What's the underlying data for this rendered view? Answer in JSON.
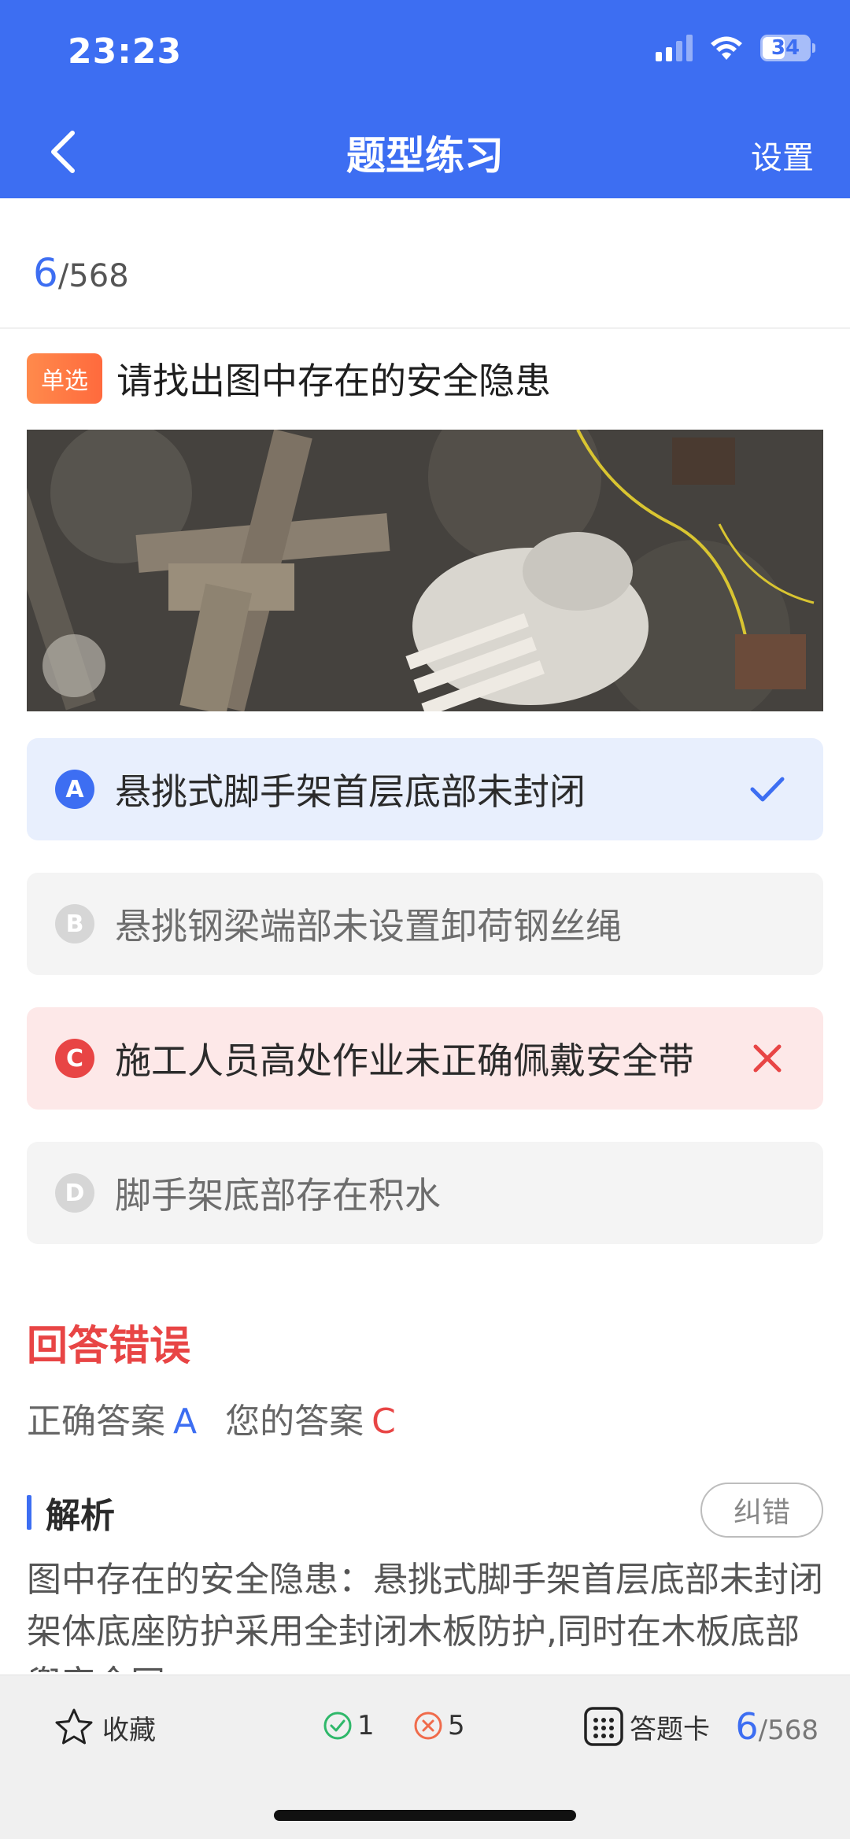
{
  "status_bar": {
    "time": "23:23",
    "battery": "34"
  },
  "nav": {
    "title": "题型练习",
    "settings_label": "设置"
  },
  "progress": {
    "current": "6",
    "total": "/568"
  },
  "question": {
    "type_badge": "单选",
    "text": "请找出图中存在的安全隐患"
  },
  "options": [
    {
      "letter": "A",
      "text": "悬挑式脚手架首层底部未封闭",
      "state": "correct"
    },
    {
      "letter": "B",
      "text": "悬挑钢梁端部未设置卸荷钢丝绳",
      "state": "neutral"
    },
    {
      "letter": "C",
      "text": "施工人员高处作业未正确佩戴安全带",
      "state": "wrong"
    },
    {
      "letter": "D",
      "text": "脚手架底部存在积水",
      "state": "neutral"
    }
  ],
  "result": {
    "title": "回答错误",
    "correct_label": "正确答案",
    "correct_value": "A",
    "mine_label": "您的答案",
    "mine_value": "C"
  },
  "analysis": {
    "title": "解析",
    "report_button": "纠错",
    "text": "图中存在的安全隐患：悬挑式脚手架首层底部未封闭架体底座防护采用全封闭木板防护,同时在木板底部兜安全网"
  },
  "bottom_bar": {
    "favorite_label": "收藏",
    "right_count": "1",
    "wrong_count": "5",
    "answer_card_label": "答题卡",
    "current": "6",
    "total": "/568"
  },
  "colors": {
    "primary": "#3d6ef2",
    "error": "#e84545",
    "badge": "#ff7a45",
    "correct_bg": "#e8effd",
    "wrong_bg": "#fde8e8"
  }
}
